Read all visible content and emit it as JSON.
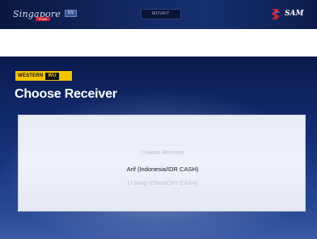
{
  "top_bar": {
    "logo_text": "Singapore",
    "logo_badge": "Pools",
    "flag_chip": "EN",
    "center_button": "MOVAIT",
    "brand_text": "SAM",
    "brand_color": "#c8223a"
  },
  "screen": {
    "provider_logo": {
      "text": "WESTERN",
      "mark": "WU"
    },
    "title": "Choose Receiver",
    "receivers": [
      {
        "label": "Choose Receiver"
      },
      {
        "label": "Arif (Indonesia/IDR CASH)"
      },
      {
        "label": "Li Sung (China/CNY CASH)"
      },
      {
        "label": ""
      }
    ],
    "accent_yellow": "#f3c400",
    "background_blue": "#122a6c"
  }
}
